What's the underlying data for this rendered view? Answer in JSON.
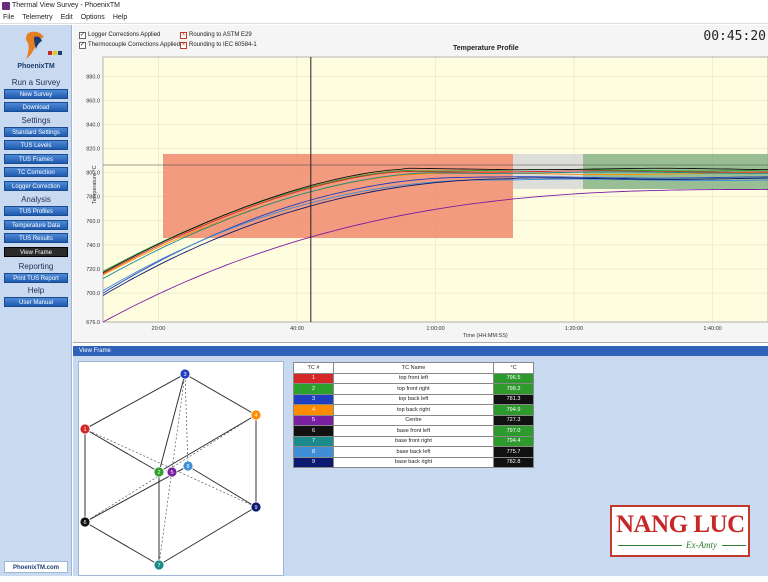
{
  "window": {
    "title": "Thermal View Survey - PhoenixTM"
  },
  "menu": [
    "File",
    "Telemetry",
    "Edit",
    "Options",
    "Help"
  ],
  "sidebar": {
    "logo_text": "PhoenixTM",
    "footer": "PhoenixTM.com",
    "sections": [
      {
        "heading": "Run a Survey",
        "buttons": [
          "New Survey",
          "Download"
        ]
      },
      {
        "heading": "Settings",
        "buttons": [
          "Standard Settings",
          "TUS Levels",
          "TUS Frames",
          "TC Correction",
          "Logger Correction"
        ]
      },
      {
        "heading": "Analysis",
        "buttons": [
          "TUS Profiles",
          "Temperature Data",
          "TUS Results",
          "View Frame"
        ]
      },
      {
        "heading": "Reporting",
        "buttons": [
          "Print TUS Report"
        ]
      },
      {
        "heading": "Help",
        "buttons": [
          "User Manual"
        ]
      }
    ],
    "active": "View Frame"
  },
  "options": {
    "logger_corrections": "Logger Corrections Applied",
    "thermocouple_corrections": "Thermocouple Corrections Applied",
    "rounding_astm": "Rounding to ASTM E29",
    "rounding_iec": "Rounding to IEC 60584-1"
  },
  "clock": "00:45:20",
  "chart_data": {
    "type": "line",
    "title": "Temperature Profile",
    "xlabel": "Time (HH:MM:SS)",
    "ylabel": "Temperature °C",
    "ylim": [
      676,
      896
    ],
    "y_ticks": [
      "676.0",
      "700.0",
      "720.0",
      "740.0",
      "760.0",
      "780.0",
      "800.0",
      "820.0",
      "840.0",
      "860.0",
      "880.0"
    ],
    "x_ticks": [
      "20:00",
      "40:00",
      "1:00:00",
      "1:20:00",
      "1:40:00"
    ],
    "x_range_min": [
      12,
      108
    ],
    "cursor_min": 42,
    "series_colors": [
      "#d62728",
      "#2ca02c",
      "#1f3fbf",
      "#ff8c00",
      "#7b1fa2",
      "#111111",
      "#1a8a8a",
      "#3f8fd6",
      "#0b1a6e"
    ]
  },
  "view_frame": {
    "header": "View Frame",
    "columns": [
      "TC #",
      "TC Name",
      "°C"
    ],
    "rows": [
      {
        "num": "1",
        "name": "top front left",
        "value": "796.5",
        "color": "#d62728",
        "valbg": "#2e9a2e"
      },
      {
        "num": "2",
        "name": "top front right",
        "value": "798.3",
        "color": "#2ca02c",
        "valbg": "#2e9a2e"
      },
      {
        "num": "3",
        "name": "top back left",
        "value": "781.3",
        "color": "#1f3fbf",
        "valbg": "#111111"
      },
      {
        "num": "4",
        "name": "top back right",
        "value": "794.9",
        "color": "#ff8c00",
        "valbg": "#2e9a2e"
      },
      {
        "num": "5",
        "name": "Centre",
        "value": "727.3",
        "color": "#7b1fa2",
        "valbg": "#111111"
      },
      {
        "num": "6",
        "name": "base front left",
        "value": "797.0",
        "color": "#111111",
        "valbg": "#2e9a2e"
      },
      {
        "num": "7",
        "name": "base front right",
        "value": "794.4",
        "color": "#1a8a8a",
        "valbg": "#2e9a2e"
      },
      {
        "num": "8",
        "name": "base back left",
        "value": "775.7",
        "color": "#3f8fd6",
        "valbg": "#111111"
      },
      {
        "num": "9",
        "name": "base back right",
        "value": "782.8",
        "color": "#0b1a6e",
        "valbg": "#111111"
      }
    ]
  },
  "watermark": {
    "main": "NANG LUC",
    "sub": "Ex-Amty"
  }
}
